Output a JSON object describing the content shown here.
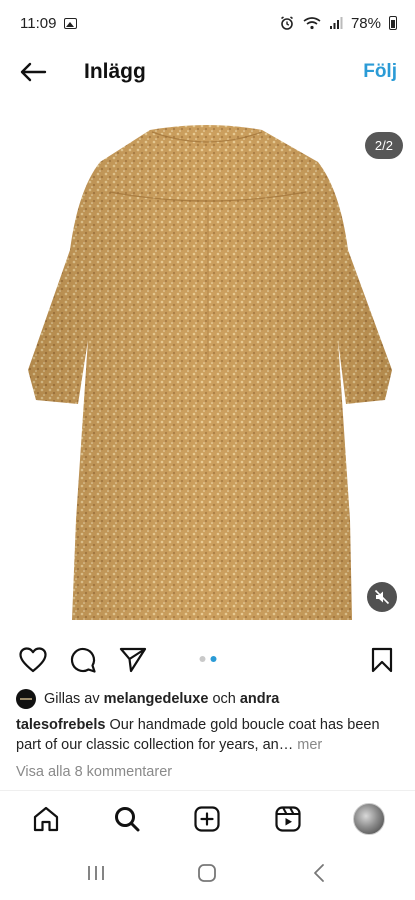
{
  "status_bar": {
    "time": "11:09",
    "battery": "78%"
  },
  "header": {
    "title": "Inlägg",
    "follow_label": "Följ"
  },
  "post": {
    "image_counter": "2/2",
    "image_subject": "gold boucle coat",
    "carousel_total": 2,
    "carousel_active_index": 1
  },
  "likes": {
    "prefix": "Gillas av",
    "user": "melangedeluxe",
    "conjunction": "och",
    "others": "andra"
  },
  "caption": {
    "username": "talesofrebels",
    "text": "Our handmade gold boucle coat has been part of our classic collection for years, an…",
    "more_label": "mer"
  },
  "comments": {
    "view_all_label": "Visa alla 8 kommentarer"
  },
  "colors": {
    "accent": "#2b9bd6",
    "coat_gold": "#c99a55"
  }
}
